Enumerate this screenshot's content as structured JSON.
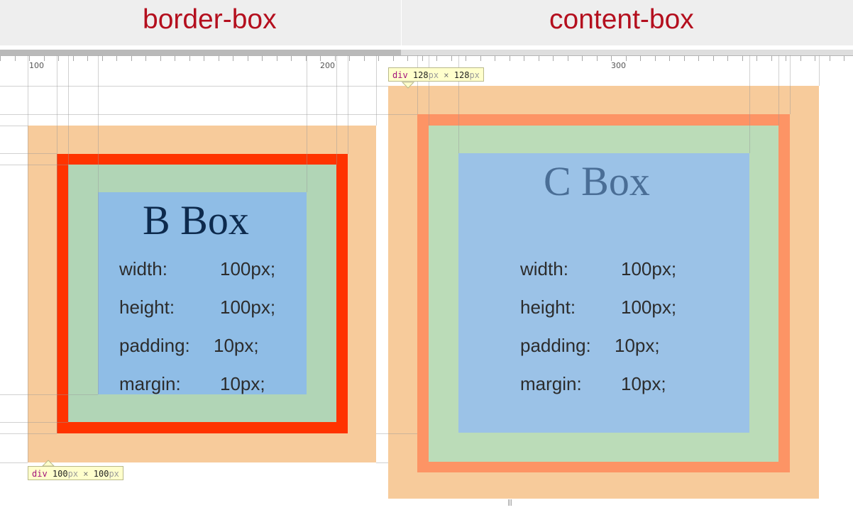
{
  "headings": {
    "left": "border-box",
    "right": "content-box"
  },
  "ruler": {
    "labels": [
      "100",
      "200",
      "300"
    ]
  },
  "left_box": {
    "title": "B Box",
    "tooltip": {
      "tag": "div",
      "width": "100",
      "height": "100",
      "unit": "px",
      "times": "×"
    },
    "properties": [
      {
        "label": "width:",
        "value": "100px;"
      },
      {
        "label": "height:",
        "value": "100px;"
      },
      {
        "label": "padding:",
        "value": "10px;"
      },
      {
        "label": "margin:",
        "value": "10px;"
      }
    ]
  },
  "right_box": {
    "title": "C Box",
    "tooltip": {
      "tag": "div",
      "width": "128",
      "height": "128",
      "unit": "px",
      "times": "×"
    },
    "properties": [
      {
        "label": "width:",
        "value": "100px;"
      },
      {
        "label": "height:",
        "value": "100px;"
      },
      {
        "label": "padding:",
        "value": "10px;"
      },
      {
        "label": "margin:",
        "value": "10px;"
      }
    ]
  },
  "scroll_grip": "|||",
  "colors": {
    "heading": "#b40f1e",
    "margin": "#f7cb9b",
    "border_left": "#ff3300",
    "border_right": "#fd9465",
    "padding_left": "#b1d5b6",
    "padding_right": "#bbdcb8",
    "content_left": "#8fbde6",
    "content_right": "#9bc2e7",
    "title_left": "#0d2a4d",
    "title_right": "#4a6e96"
  }
}
